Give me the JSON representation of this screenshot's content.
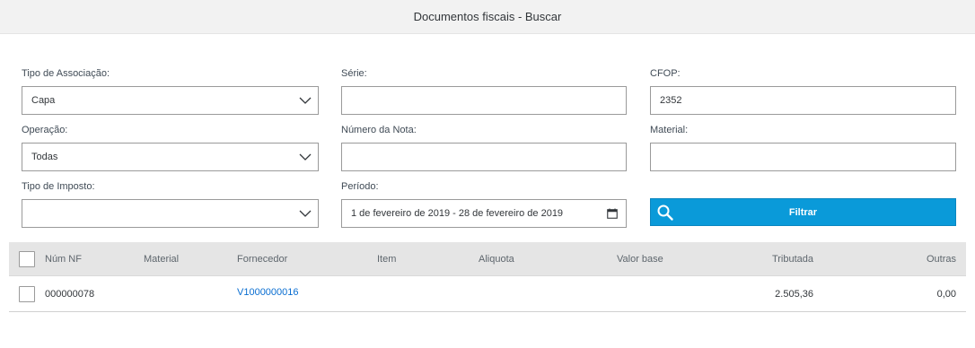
{
  "header": {
    "title": "Documentos fiscais - Buscar"
  },
  "form": {
    "tipo_associacao": {
      "label": "Tipo de Associação:",
      "value": "Capa"
    },
    "serie": {
      "label": "Série:",
      "value": ""
    },
    "cfop": {
      "label": "CFOP:",
      "value": "2352"
    },
    "operacao": {
      "label": "Operação:",
      "value": "Todas"
    },
    "numero_nota": {
      "label": "Número da Nota:",
      "value": ""
    },
    "material": {
      "label": "Material:",
      "value": ""
    },
    "tipo_imposto": {
      "label": "Tipo de Imposto:",
      "value": ""
    },
    "periodo": {
      "label": "Período:",
      "value": "1 de fevereiro de 2019 - 28 de fevereiro de 2019"
    },
    "filter_button": {
      "label": "Filtrar"
    }
  },
  "table": {
    "columns": [
      "Núm NF",
      "Material",
      "Fornecedor",
      "Item",
      "Aliquota",
      "Valor base",
      "Tributada",
      "Outras"
    ],
    "rows": [
      {
        "num_nf": "000000078",
        "material": "",
        "fornecedor": "V1000000016",
        "item": "",
        "aliquota": "",
        "valor_base": "",
        "tributada": "2.505,36",
        "outras": "0,00"
      }
    ]
  },
  "colors": {
    "accent": "#0a9ad9",
    "link": "#0a6ed1",
    "header_bg": "#f2f2f2",
    "table_header_bg": "#e5e5e5"
  }
}
